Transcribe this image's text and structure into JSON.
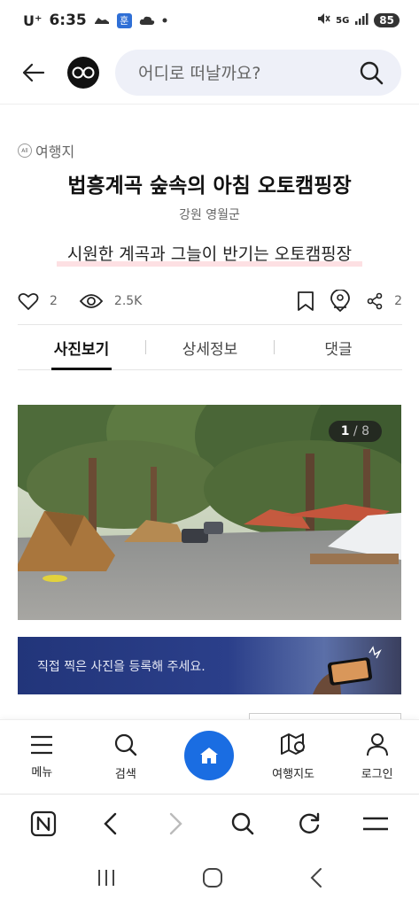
{
  "status_bar": {
    "carrier": "U⁺",
    "time": "6:35",
    "hoon_badge": "훈",
    "battery": "85",
    "network": "5G"
  },
  "header": {
    "search_placeholder": "어디로 떠날까요?"
  },
  "article": {
    "category": "여행지",
    "category_badge": "All",
    "title": "법흥계곡 숲속의 아침 오토캠핑장",
    "location": "강원 영월군",
    "subtitle": "시원한 계곡과 그늘이 반기는 오토캠핑장",
    "likes": "2",
    "views": "2.5K",
    "shares": "2"
  },
  "tabs": [
    {
      "label": "사진보기",
      "active": true
    },
    {
      "label": "상세정보",
      "active": false
    },
    {
      "label": "댓글",
      "active": false
    }
  ],
  "photo": {
    "current": "1",
    "separator": " / ",
    "total": "8"
  },
  "banner": {
    "text": "직접 찍은 사진을 등록해 주세요."
  },
  "bottom_nav": [
    {
      "label": "메뉴",
      "icon": "menu-icon"
    },
    {
      "label": "검색",
      "icon": "search-icon"
    },
    {
      "label": "",
      "icon": "home-icon"
    },
    {
      "label": "여행지도",
      "icon": "map-icon"
    },
    {
      "label": "로그인",
      "icon": "user-icon"
    }
  ],
  "colors": {
    "accent_blue": "#1a6de2",
    "search_bg": "#eef0f8",
    "highlight_pink": "#fde0e3",
    "banner_navy": "#22357a"
  }
}
